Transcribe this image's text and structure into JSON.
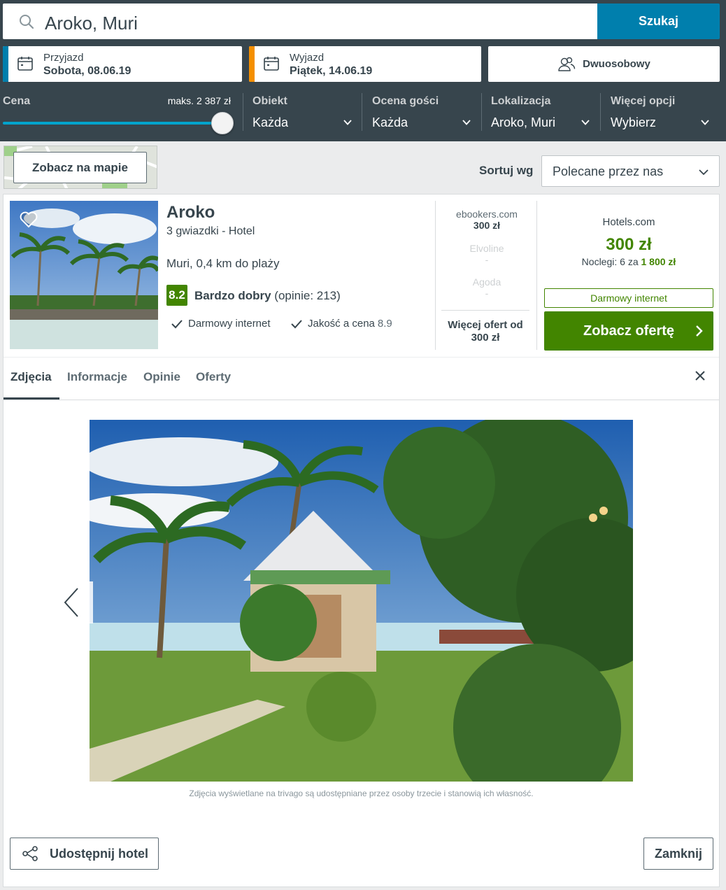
{
  "search": {
    "query": "Aroko, Muri",
    "button": "Szukaj"
  },
  "dates": {
    "checkin_label": "Przyjazd",
    "checkin_value": "Sobota, 08.06.19",
    "checkout_label": "Wyjazd",
    "checkout_value": "Piątek, 14.06.19",
    "checkin_color": "#007fad",
    "checkout_color": "#f48f00"
  },
  "room": {
    "label": "Dwuosobowy"
  },
  "filters": {
    "price_label": "Cena",
    "price_max": "maks. 2 387 zł",
    "object_label": "Obiekt",
    "object_value": "Każda",
    "rating_label": "Ocena gości",
    "rating_value": "Każda",
    "location_label": "Lokalizacja",
    "location_value": "Aroko, Muri",
    "more_label": "Więcej opcji",
    "more_value": "Wybierz"
  },
  "map": {
    "button": "Zobacz na mapie"
  },
  "sort": {
    "label": "Sortuj wg",
    "value": "Polecane przez nas"
  },
  "hotel": {
    "name": "Aroko",
    "type": "3 gwiazdki - Hotel",
    "location": "Muri, 0,4 km do plaży",
    "rating_score": "8.2",
    "rating_word": "Bardzo dobry",
    "rating_reviews": "(opinie: 213)",
    "amenity1": "Darmowy internet",
    "amenity2": "Jakość a cena",
    "amenity2_score": "8.9"
  },
  "deals": [
    {
      "name": "ebookers.com",
      "price": "300 zł"
    },
    {
      "name": "Elvoline",
      "price": "-"
    },
    {
      "name": "Agoda",
      "price": "-"
    }
  ],
  "more_deals": {
    "line1": "Więcej ofert od",
    "line2": "300 zł"
  },
  "best_deal": {
    "name": "Hotels.com",
    "price": "300 zł",
    "nights_prefix": "Noclegi: 6 za",
    "nights_total": "1 800 zł",
    "tag": "Darmowy internet",
    "button": "Zobacz ofertę"
  },
  "tabs": [
    "Zdjęcia",
    "Informacje",
    "Opinie",
    "Oferty"
  ],
  "gallery": {
    "credit": "Zdjęcia wyświetlane na trivago są udostępniane przez osoby trzecie i stanowią ich własność."
  },
  "footer": {
    "share": "Udostępnij hotel",
    "close": "Zamknij"
  },
  "colors": {
    "topbar": "#37454d",
    "accent": "#007fad",
    "green": "#428500"
  }
}
